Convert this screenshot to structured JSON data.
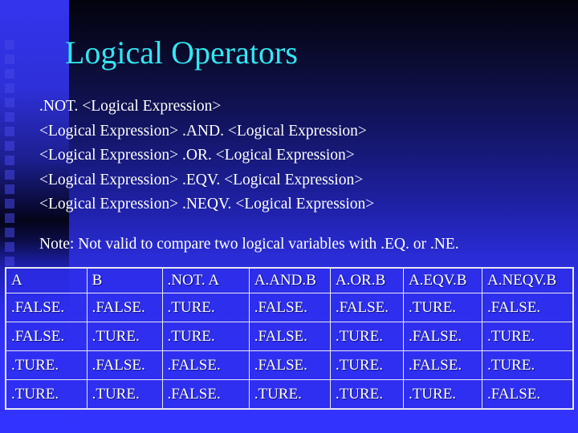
{
  "slide": {
    "title": "Logical Operators",
    "syntax_lines": [
      ".NOT. <Logical Expression>",
      "<Logical Expression> .AND. <Logical Expression>",
      "<Logical Expression> .OR. <Logical Expression>",
      "<Logical Expression> .EQV. <Logical Expression>",
      "<Logical Expression> .NEQV. <Logical Expression>"
    ],
    "note": "Note: Not valid to compare two logical variables with .EQ. or .NE.",
    "colors": {
      "title": "#33e6f0",
      "text": "#ffffff",
      "background_top": "#03030d",
      "background_bottom": "#3333ff",
      "table_fill": "#2e2eee"
    }
  },
  "truth_table": {
    "headers": [
      "A",
      "B",
      ".NOT. A",
      "A.AND.B",
      "A.OR.B",
      "A.EQV.B",
      "A.NEQV.B"
    ],
    "rows": [
      [
        ".FALSE.",
        ".FALSE.",
        ".TURE.",
        ".FALSE.",
        ".FALSE.",
        ".TURE.",
        ".FALSE."
      ],
      [
        ".FALSE.",
        ".TURE.",
        ".TURE.",
        ".FALSE.",
        ".TURE.",
        ".FALSE.",
        ".TURE."
      ],
      [
        ".TURE.",
        ".FALSE.",
        ".FALSE.",
        ".FALSE.",
        ".TURE.",
        ".FALSE.",
        ".TURE."
      ],
      [
        ".TURE.",
        ".TURE.",
        ".FALSE.",
        ".TURE.",
        ".TURE.",
        ".TURE.",
        ".FALSE."
      ]
    ]
  }
}
